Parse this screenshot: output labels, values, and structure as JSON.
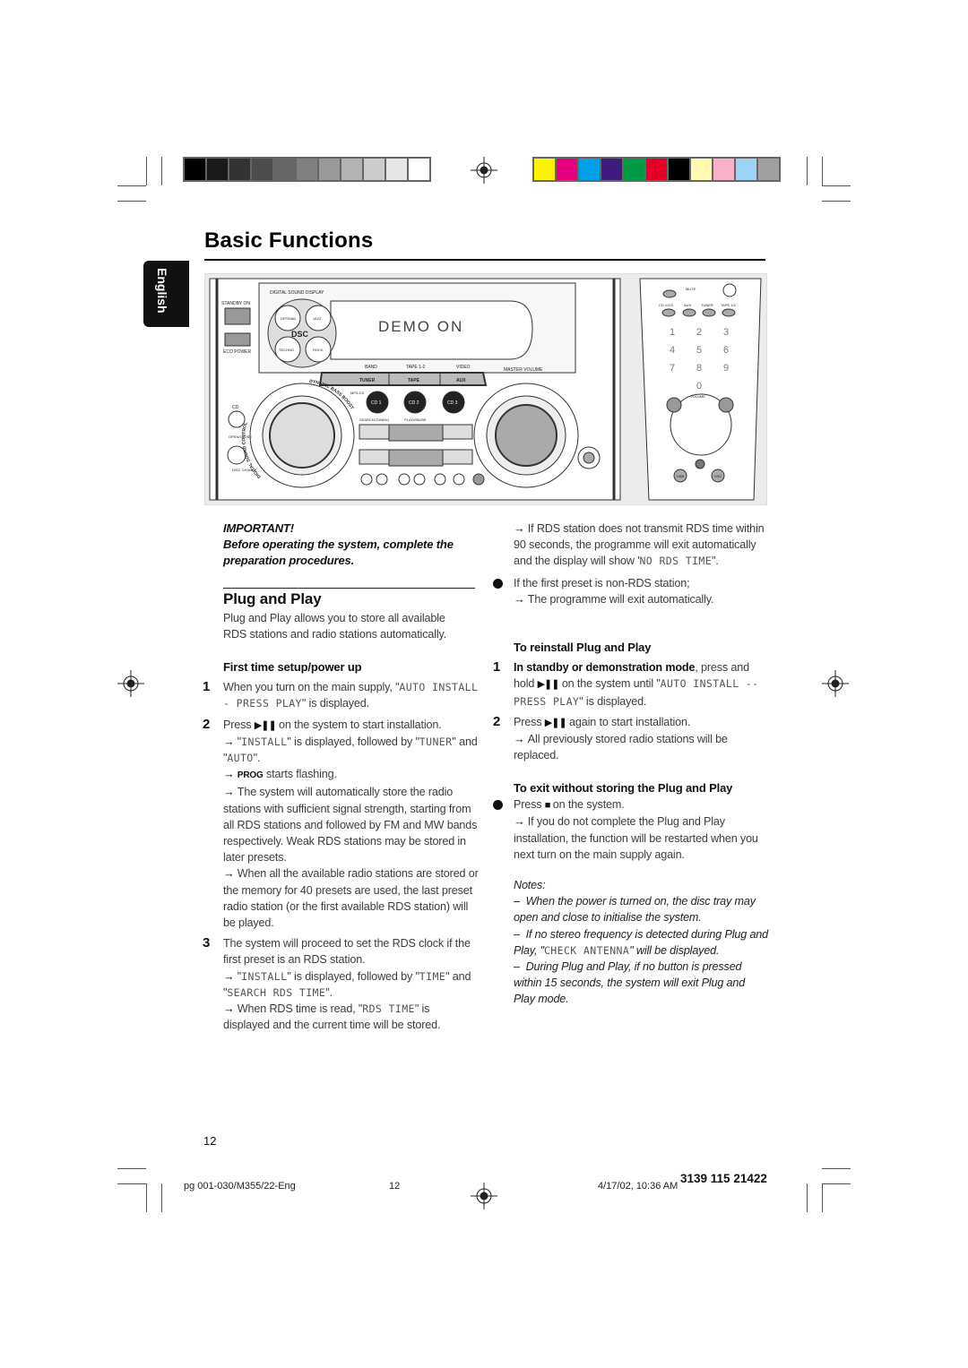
{
  "print_marks": {
    "gray_scale": [
      "#000000",
      "#1a1a1a",
      "#333333",
      "#4d4d4d",
      "#666666",
      "#808080",
      "#999999",
      "#b3b3b3",
      "#cccccc",
      "#e6e6e6",
      "#ffffff"
    ],
    "color_bar": [
      "#fff200",
      "#e4007f",
      "#00a0e9",
      "#3e1c7f",
      "#009944",
      "#e60026",
      "#000000",
      "#fff9b1",
      "#f7b2c9",
      "#9dd3f5",
      "#a0a0a0"
    ]
  },
  "header": {
    "title": "Basic Functions",
    "language_tab": "English"
  },
  "illustration": {
    "digital_sound_display": "DIGITAL SOUND DISPLAY",
    "standby_on": "STANDBY ON",
    "eco_power": "ECO POWER",
    "dsc": "DSC",
    "dsc_modes": [
      "OPTIMAL",
      "JAZZ",
      "TECHNO",
      "ROCK"
    ],
    "display_text": "DEMO ON",
    "band": "BAND",
    "tape12": "TAPE 1-2",
    "video": "VIDEO",
    "master_volume": "MASTER VOLUME",
    "sources": [
      "TUNER",
      "TAPE",
      "AUX"
    ],
    "mp3_cd": "MP3-CD",
    "cd_buttons": [
      "CD 1",
      "CD 2",
      "CD 3"
    ],
    "search_tuning": "SEARCH•TUNING",
    "play_pause": "PLAY•PAUSE",
    "cd_label": "CD",
    "open_close": "OPEN/CLOSE",
    "disc_change": "DISC CHANGE",
    "dsc_ring": "DIGITAL SOUND CONTROL",
    "dbb_ring": "DYNAMIC BASS BOOST",
    "remote": {
      "mute": "MUTE",
      "sources": [
        "CD 1/2/3",
        "AUX",
        "TUNER",
        "TAPE 1/2"
      ],
      "digits": [
        "1",
        "2",
        "3",
        "4",
        "5",
        "6",
        "7",
        "8",
        "9",
        "0"
      ],
      "volume": "VOLUME",
      "dbb": "DBB",
      "dsc": "DSC"
    }
  },
  "important": {
    "title": "IMPORTANT!",
    "text": "Before operating the system, complete the preparation procedures."
  },
  "plug_and_play": {
    "heading": "Plug and Play",
    "intro": "Plug and Play allows you to store all available RDS stations and radio stations automatically.",
    "first_time": {
      "heading": "First time setup/power up",
      "step1": {
        "num": "1",
        "a": "When you turn on the main supply, \"",
        "lcd": "AUTO INSTALL - PRESS PLAY",
        "b": "\" is displayed."
      },
      "step2": {
        "num": "2",
        "a": "Press ",
        "sym": "▶❚❚",
        "b": " on the system to start installation.",
        "r1a": "\"",
        "r1lcd": "INSTALL",
        "r1b": "\" is displayed, followed by \"",
        "r1lcd2": "TUNER",
        "r1c": "\" and \"",
        "r1lcd3": "AUTO",
        "r1d": "\".",
        "r2sc": "PROG",
        "r2": " starts flashing.",
        "r3": "The system will automatically store the radio stations with sufficient signal strength, starting from all RDS stations and followed by FM and MW bands respectively. Weak RDS stations may be stored in later presets.",
        "r4": "When all the available radio stations are stored or the memory for 40 presets are used, the last preset radio station (or the first available RDS station) will be played."
      },
      "step3": {
        "num": "3",
        "a": "The system will proceed to set the RDS clock if the first preset is an RDS station.",
        "r1a": "\"",
        "r1lcd": "INSTALL",
        "r1b": "\" is displayed, followed by \"",
        "r1lcd2": "TIME",
        "r1c": "\" and \"",
        "r1lcd3": "SEARCH RDS TIME",
        "r1d": "\".",
        "r2a": "When RDS time is read, \"",
        "r2lcd": "RDS TIME",
        "r2b": "\" is displayed and the current time will be stored."
      }
    },
    "right": {
      "r1a": "If RDS station does not transmit RDS time within 90 seconds, the programme will exit automatically and the display will show '",
      "r1lcd": "NO RDS TIME",
      "r1b": "\".",
      "bullet": "If the first preset is non-RDS station;",
      "bullet_r": "The programme will exit automatically."
    },
    "reinstall": {
      "heading": "To reinstall Plug and Play",
      "step1": {
        "num": "1",
        "bold": "In standby or demonstration mode",
        "a": ", press and hold ",
        "sym": "▶❚❚",
        "b": " on the system until \"",
        "lcd": "AUTO INSTALL -- PRESS PLAY",
        "c": "\" is displayed."
      },
      "step2": {
        "num": "2",
        "a": "Press ",
        "sym": "▶❚❚",
        "b": " again to start installation.",
        "r": "All previously stored radio stations will be replaced."
      }
    },
    "exit": {
      "heading": "To exit without storing the Plug and Play",
      "a": "Press ",
      "sym": "■",
      "b": " on the system.",
      "r": "If you do not complete the Plug and Play installation, the function will be restarted when you next turn on the main supply again."
    },
    "notes": {
      "title": "Notes:",
      "n1": "When the power is turned on, the disc tray may open and close to initialise the system.",
      "n2a": "If no stereo frequency is detected during Plug and Play, \"",
      "n2lcd": "CHECK ANTENNA",
      "n2b": "\" will be displayed.",
      "n3": "During Plug and Play, if no button is pressed within 15 seconds, the system will exit Plug and Play mode."
    }
  },
  "page_number": "12",
  "footer": {
    "file": "pg 001-030/M355/22-Eng",
    "page": "12",
    "date": "4/17/02, 10:36 AM",
    "code": "3139 115 21422"
  }
}
